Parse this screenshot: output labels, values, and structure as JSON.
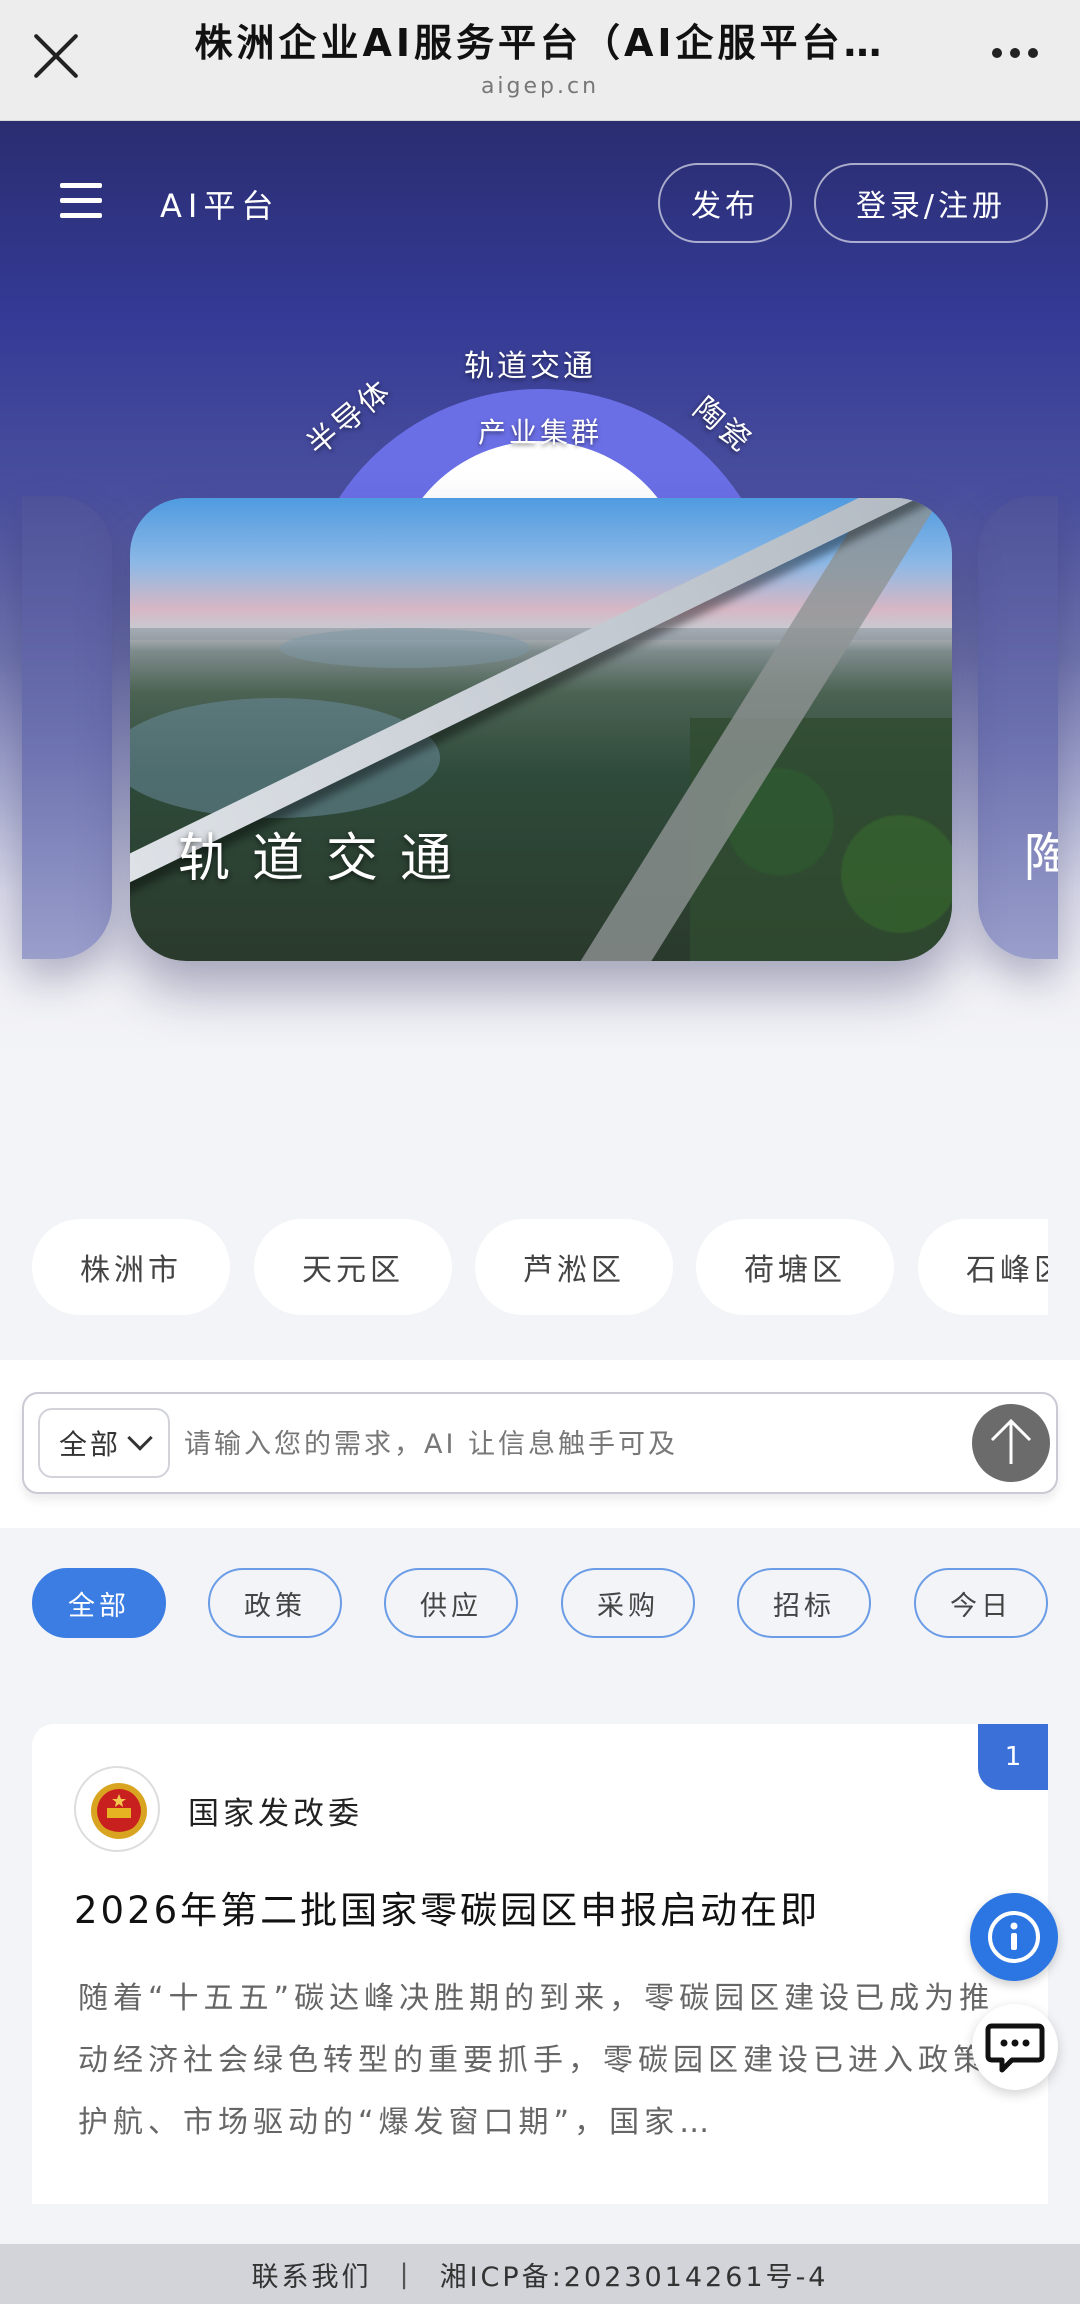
{
  "window": {
    "title": "株洲企业AI服务平台（AI企服平台…",
    "domain": "aigep.cn"
  },
  "header": {
    "brand": "AI平台",
    "publish_label": "发布",
    "login_label": "登录/注册"
  },
  "carousel": {
    "center_label": "轨道交通",
    "center_sublabel": "产业集群",
    "left_label": "半导体",
    "right_label": "陶瓷",
    "card_caption": "轨道交通",
    "next_card_peek": "陶"
  },
  "districts": [
    "株洲市",
    "天元区",
    "芦淞区",
    "荷塘区",
    "石峰区"
  ],
  "search": {
    "scope_label": "全部",
    "placeholder": "请输入您的需求，AI 让信息触手可及"
  },
  "categories": [
    {
      "label": "全部",
      "active": true
    },
    {
      "label": "政策",
      "active": false
    },
    {
      "label": "供应",
      "active": false
    },
    {
      "label": "采购",
      "active": false
    },
    {
      "label": "招标",
      "active": false
    },
    {
      "label": "今日",
      "active": false
    }
  ],
  "news": {
    "badge": "1",
    "source": "国家发改委",
    "headline": "2026年第二批国家零碳园区申报启动在即",
    "summary": "随着“十五五”碳达峰决胜期的到来，零碳园区建设已成为推动经济社会绿色转型的重要抓手，零碳园区建设已进入政策护航、市场驱动的“爆发窗口期”，国家…"
  },
  "footer": {
    "contact": "联系我们",
    "separator": "|",
    "icp": "湘ICP备:2023014261号-4"
  },
  "colors": {
    "accent": "#3b7de3",
    "hero_top": "#2a2d70",
    "arc": "#6b6fe6"
  },
  "icons": {
    "close": "close-icon",
    "more": "more-icon",
    "menu": "menu-icon",
    "send": "arrow-up-icon",
    "info": "info-icon",
    "chat": "chat-icon"
  }
}
